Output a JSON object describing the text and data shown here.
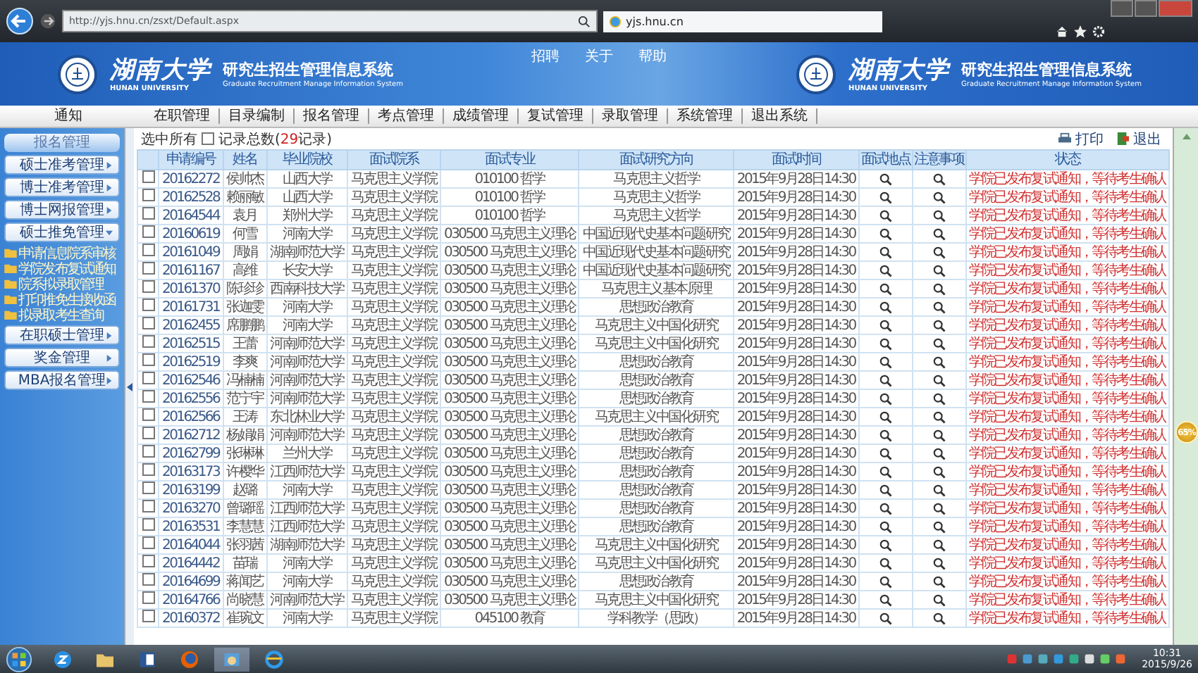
{
  "browser": {
    "url": "http://yjs.hnu.cn/zsxt/Default.aspx",
    "tab": "yjs.hnu.cn"
  },
  "header": {
    "logos": [
      {
        "name": "湖南大学",
        "name_en": "HUNAN UNIVERSITY",
        "title": "研究生招生管理信息系统",
        "subtitle": "Graduate Recruitment Manage Information System"
      },
      {
        "name": "湖南大学",
        "name_en": "HUNAN UNIVERSITY",
        "title": "研究生招生管理信息系统",
        "subtitle": "Graduate Recruitment Manage Information System"
      }
    ],
    "links": [
      "招聘",
      "关于",
      "帮助"
    ]
  },
  "nav": [
    "通知",
    "在职管理",
    "目录编制",
    "报名管理",
    "考点管理",
    "成绩管理",
    "复试管理",
    "录取管理",
    "系统管理",
    "退出系统"
  ],
  "sidebar": {
    "title": "报名管理",
    "items": [
      {
        "label": "硕士准考管理",
        "expanded": false
      },
      {
        "label": "博士准考管理",
        "expanded": false
      },
      {
        "label": "博士网报管理",
        "expanded": false
      },
      {
        "label": "硕士推免管理",
        "expanded": true,
        "children": [
          {
            "label": "申请信息院系审核"
          },
          {
            "label": "学院发布复试通知"
          },
          {
            "label": "院系拟录取管理"
          },
          {
            "label": "打印推免生接收函"
          },
          {
            "label": "拟录取考生查询"
          }
        ]
      },
      {
        "label": "在职硕士管理",
        "expanded": false
      },
      {
        "label": "奖金管理",
        "expanded": false
      },
      {
        "label": "MBA报名管理",
        "expanded": false
      }
    ]
  },
  "toolbar": {
    "select_all": {
      "label": "选中所有",
      "checked": false
    },
    "record_count": {
      "prefix": "记录总数(",
      "count": "29",
      "suffix": "记录)"
    },
    "actions": [
      {
        "kind": "print",
        "label": "打印"
      },
      {
        "kind": "exit",
        "label": "退出"
      }
    ]
  },
  "table": {
    "columns": [
      "申请编号",
      "姓名",
      "毕业院校",
      "面试院系",
      "面试专业",
      "面试研究方向",
      "面试时间",
      "面试地点",
      "注意事项",
      "状态"
    ],
    "rows": [
      {
        "checked": false,
        "cells": [
          "20162272",
          "侯帅杰",
          "山西大学",
          "马克思主义学院",
          "010100 哲学",
          "马克思主义哲学",
          "2015年9月28日14:30"
        ],
        "status": "学院已发布复试通知，等待考生确认"
      },
      {
        "checked": false,
        "cells": [
          "20162528",
          "赖丽敏",
          "山西大学",
          "马克思主义学院",
          "010100 哲学",
          "马克思主义哲学",
          "2015年9月28日14:30"
        ],
        "status": "学院已发布复试通知，等待考生确认"
      },
      {
        "checked": false,
        "cells": [
          "20164544",
          "袁月",
          "郑州大学",
          "马克思主义学院",
          "010100 哲学",
          "马克思主义哲学",
          "2015年9月28日14:30"
        ],
        "status": "学院已发布复试通知，等待考生确认"
      },
      {
        "checked": false,
        "cells": [
          "20160619",
          "何雪",
          "河南大学",
          "马克思主义学院",
          "030500 马克思主义理论",
          "中国近现代史基本问题研究",
          "2015年9月28日14:30"
        ],
        "status": "学院已发布复试通知，等待考生确认"
      },
      {
        "checked": false,
        "cells": [
          "20161049",
          "周娟",
          "湖南师范大学",
          "马克思主义学院",
          "030500 马克思主义理论",
          "中国近现代史基本问题研究",
          "2015年9月28日14:30"
        ],
        "status": "学院已发布复试通知，等待考生确认"
      },
      {
        "checked": false,
        "cells": [
          "20161167",
          "高维",
          "长安大学",
          "马克思主义学院",
          "030500 马克思主义理论",
          "中国近现代史基本问题研究",
          "2015年9月28日14:30"
        ],
        "status": "学院已发布复试通知，等待考生确认"
      },
      {
        "checked": false,
        "cells": [
          "20161370",
          "陈珍珍",
          "西南科技大学",
          "马克思主义学院",
          "030500 马克思主义理论",
          "马克思主义基本原理",
          "2015年9月28日14:30"
        ],
        "status": "学院已发布复试通知，等待考生确认"
      },
      {
        "checked": false,
        "cells": [
          "20161731",
          "张迦雯",
          "河南大学",
          "马克思主义学院",
          "030500 马克思主义理论",
          "思想政治教育",
          "2015年9月28日14:30"
        ],
        "status": "学院已发布复试通知，等待考生确认"
      },
      {
        "checked": false,
        "cells": [
          "20162455",
          "席鹏鹏",
          "河南大学",
          "马克思主义学院",
          "030500 马克思主义理论",
          "马克思主义中国化研究",
          "2015年9月28日14:30"
        ],
        "status": "学院已发布复试通知，等待考生确认"
      },
      {
        "checked": false,
        "cells": [
          "20162515",
          "王蕾",
          "河南师范大学",
          "马克思主义学院",
          "030500 马克思主义理论",
          "马克思主义中国化研究",
          "2015年9月28日14:30"
        ],
        "status": "学院已发布复试通知，等待考生确认"
      },
      {
        "checked": false,
        "cells": [
          "20162519",
          "李爽",
          "河南师范大学",
          "马克思主义学院",
          "030500 马克思主义理论",
          "思想政治教育",
          "2015年9月28日14:30"
        ],
        "status": "学院已发布复试通知，等待考生确认"
      },
      {
        "checked": false,
        "cells": [
          "20162546",
          "冯楠楠",
          "河南师范大学",
          "马克思主义学院",
          "030500 马克思主义理论",
          "思想政治教育",
          "2015年9月28日14:30"
        ],
        "status": "学院已发布复试通知，等待考生确认"
      },
      {
        "checked": false,
        "cells": [
          "20162556",
          "范宁宇",
          "河南师范大学",
          "马克思主义学院",
          "030500 马克思主义理论",
          "思想政治教育",
          "2015年9月28日14:30"
        ],
        "status": "学院已发布复试通知，等待考生确认"
      },
      {
        "checked": false,
        "cells": [
          "20162566",
          "王涛",
          "东北林业大学",
          "马克思主义学院",
          "030500 马克思主义理论",
          "马克思主义中国化研究",
          "2015年9月28日14:30"
        ],
        "status": "学院已发布复试通知，等待考生确认"
      },
      {
        "checked": false,
        "cells": [
          "20162712",
          "杨娟娟",
          "河南师范大学",
          "马克思主义学院",
          "030500 马克思主义理论",
          "思想政治教育",
          "2015年9月28日14:30"
        ],
        "status": "学院已发布复试通知，等待考生确认"
      },
      {
        "checked": false,
        "cells": [
          "20162799",
          "张琳琳",
          "兰州大学",
          "马克思主义学院",
          "030500 马克思主义理论",
          "思想政治教育",
          "2015年9月28日14:30"
        ],
        "status": "学院已发布复试通知，等待考生确认"
      },
      {
        "checked": false,
        "cells": [
          "20163173",
          "许樱华",
          "江西师范大学",
          "马克思主义学院",
          "030500 马克思主义理论",
          "思想政治教育",
          "2015年9月28日14:30"
        ],
        "status": "学院已发布复试通知，等待考生确认"
      },
      {
        "checked": false,
        "cells": [
          "20163199",
          "赵璐",
          "河南大学",
          "马克思主义学院",
          "030500 马克思主义理论",
          "思想政治教育",
          "2015年9月28日14:30"
        ],
        "status": "学院已发布复试通知，等待考生确认"
      },
      {
        "checked": false,
        "cells": [
          "20163270",
          "曾璐瑶",
          "江西师范大学",
          "马克思主义学院",
          "030500 马克思主义理论",
          "思想政治教育",
          "2015年9月28日14:30"
        ],
        "status": "学院已发布复试通知，等待考生确认"
      },
      {
        "checked": false,
        "cells": [
          "20163531",
          "李慧慧",
          "江西师范大学",
          "马克思主义学院",
          "030500 马克思主义理论",
          "思想政治教育",
          "2015年9月28日14:30"
        ],
        "status": "学院已发布复试通知，等待考生确认"
      },
      {
        "checked": false,
        "cells": [
          "20164044",
          "张羽茜",
          "湖南师范大学",
          "马克思主义学院",
          "030500 马克思主义理论",
          "马克思主义中国化研究",
          "2015年9月28日14:30"
        ],
        "status": "学院已发布复试通知，等待考生确认"
      },
      {
        "checked": false,
        "cells": [
          "20164442",
          "苗瑞",
          "河南大学",
          "马克思主义学院",
          "030500 马克思主义理论",
          "马克思主义中国化研究",
          "2015年9月28日14:30"
        ],
        "status": "学院已发布复试通知，等待考生确认"
      },
      {
        "checked": false,
        "cells": [
          "20164699",
          "蒋闻艺",
          "河南大学",
          "马克思主义学院",
          "030500 马克思主义理论",
          "思想政治教育",
          "2015年9月28日14:30"
        ],
        "status": "学院已发布复试通知，等待考生确认"
      },
      {
        "checked": false,
        "cells": [
          "20164766",
          "尚晓慧",
          "河南师范大学",
          "马克思主义学院",
          "030500 马克思主义理论",
          "马克思主义中国化研究",
          "2015年9月28日14:30"
        ],
        "status": "学院已发布复试通知，等待考生确认"
      },
      {
        "checked": false,
        "cells": [
          "20160372",
          "崔琬文",
          "河南大学",
          "马克思主义学院",
          "045100 教育",
          "学科教学（思政）",
          "2015年9月28日14:30"
        ],
        "status": "学院已发布复试通知，等待考生确认"
      }
    ]
  },
  "overlay": {
    "value": "65%"
  },
  "taskbar": {
    "time": "10:31",
    "date": "2015/9/26"
  }
}
